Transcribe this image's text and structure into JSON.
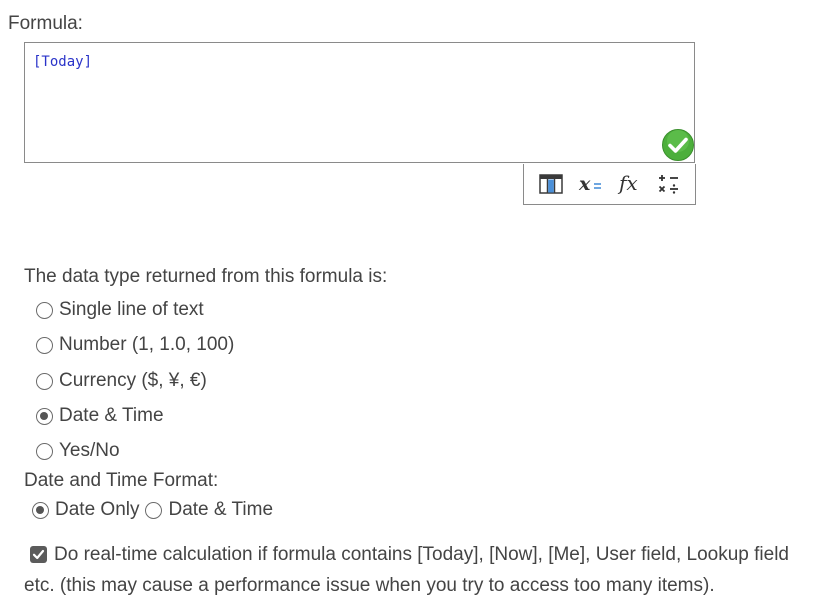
{
  "formula_label": "Formula:",
  "formula_value": "[Today]",
  "validation_icon": "green-check-icon",
  "toolbar": {
    "buttons": [
      {
        "icon": "columns-icon"
      },
      {
        "icon": "variable-icon"
      },
      {
        "icon": "function-icon"
      },
      {
        "icon": "operators-icon"
      }
    ]
  },
  "data_type": {
    "label": "The data type returned from this formula is:",
    "options": [
      {
        "label": "Single line of text",
        "selected": false
      },
      {
        "label": "Number (1, 1.0, 100)",
        "selected": false
      },
      {
        "label": "Currency ($, ¥, €)",
        "selected": false
      },
      {
        "label": "Date & Time",
        "selected": true
      },
      {
        "label": "Yes/No",
        "selected": false
      }
    ]
  },
  "date_format": {
    "label": "Date and Time Format:",
    "options": [
      {
        "label": "Date Only",
        "selected": true
      },
      {
        "label": "Date & Time",
        "selected": false
      }
    ]
  },
  "realtime": {
    "checked": true,
    "label_line1": "Do real-time calculation if formula contains [Today], [Now], [Me], User field, Lookup field",
    "label_line2": "etc. (this may cause a performance issue when you try to access too many items)."
  },
  "colors": {
    "accent": "#2a33c9",
    "check_green": "#4caf3b",
    "radio_fill": "#555555"
  }
}
